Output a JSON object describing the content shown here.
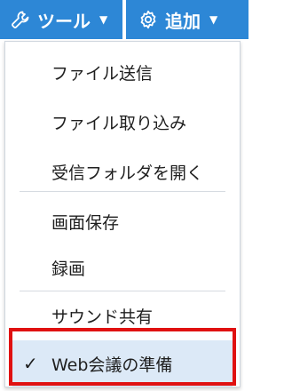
{
  "toolbar": {
    "tools_label": "ツール",
    "add_label": "追加",
    "tools_icon": "wrench-icon",
    "add_icon": "gear-icon",
    "accent_color": "#2d87d6"
  },
  "menu": {
    "items": [
      {
        "label": "ファイル送信"
      },
      {
        "label": "ファイル取り込み"
      },
      {
        "label": "受信フォルダを開く"
      },
      {
        "label": "画面保存"
      },
      {
        "label": "録画"
      },
      {
        "label": "サウンド共有"
      },
      {
        "label": "Web会議の準備",
        "checked": true
      }
    ],
    "highlight_color": "#e01111"
  }
}
